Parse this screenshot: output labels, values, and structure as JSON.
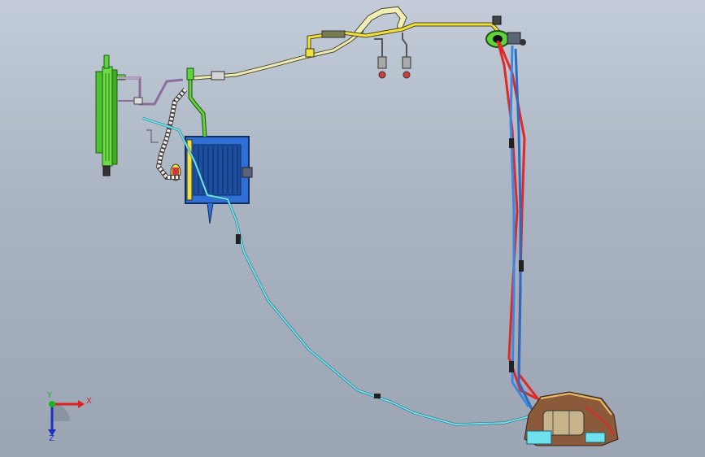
{
  "axis_triad": {
    "x_label": "X",
    "y_label": "Y",
    "z_label": "Z",
    "x_color": "#e02020",
    "y_color": "#20b020",
    "z_color": "#2030c0"
  },
  "colors": {
    "background_top": "#c3ccd8",
    "background_bottom": "#9ba5b3",
    "condenser_green": "#5fd43a",
    "heater_core_blue": "#2f6fd6",
    "pipe_cream": "#efe9b4",
    "pipe_yellow": "#f1e23a",
    "hose_cyan": "#5fd0e0",
    "hose_blue": "#3a88e0",
    "hose_red": "#e02828",
    "compressor_tan": "#c8b48a"
  }
}
